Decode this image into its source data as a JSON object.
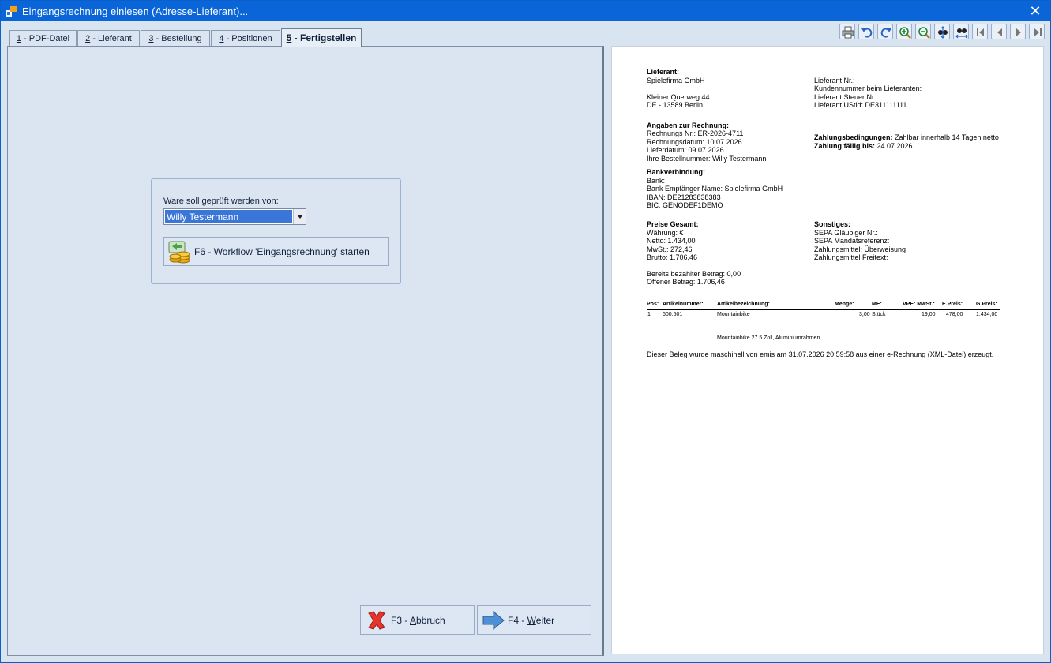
{
  "window": {
    "title": "Eingangsrechnung einlesen (Adresse-Lieferant)...",
    "close": "✕"
  },
  "tabs": [
    {
      "key": "1",
      "label": " - PDF-Datei"
    },
    {
      "key": "2",
      "label": " - Lieferant"
    },
    {
      "key": "3",
      "label": " - Bestellung"
    },
    {
      "key": "4",
      "label": " - Positionen"
    },
    {
      "key": "5",
      "label": " - Fertigstellen"
    }
  ],
  "check": {
    "label": "Ware soll geprüft werden von:",
    "selected": "Willy Testermann"
  },
  "workflow_button": "F6 - Workflow 'Eingangsrechnung' starten",
  "cancel_button": {
    "prefix": "F3 - ",
    "key": "A",
    "rest": "bbruch"
  },
  "next_button": {
    "prefix": "F4 - ",
    "key": "W",
    "rest": "eiter"
  },
  "doc": {
    "supplier_head": "Lieferant:",
    "supplier_name": "Spielefirma GmbH",
    "street": "Kleiner Querweg 44",
    "city": "DE - 13589 Berlin",
    "supplier_no": "Lieferant Nr.:",
    "customer_no": "Kundennummer beim Lieferanten:",
    "tax_no": "Lieferant Steuer Nr.:",
    "vat_id": "Lieferant UStid: DE311111111",
    "invoice_head": "Angaben zur Rechnung:",
    "invoice_no": "Rechnungs Nr.: ER-2026-4711",
    "invoice_date": "Rechnungsdatum: 10.07.2026",
    "delivery_date": "Lieferdatum: 09.07.2026",
    "order_no": "Ihre Bestellnummer: Willy Testermann",
    "terms_label": "Zahlungsbedingungen:",
    "terms_value": " Zahlbar innerhalb 14 Tagen netto",
    "due_label": "Zahlung fällig bis:",
    "due_value": " 24.07.2026",
    "bank_head": "Bankverbindung:",
    "bank": "Bank:",
    "bank_recipient": "Bank Empfänger Name: Spielefirma GmbH",
    "iban": "IBAN: DE21283838383",
    "bic": "BIC: GENODEF1DEMO",
    "prices_head": "Preise Gesamt:",
    "currency": "Währung: €",
    "net": "Netto: 1.434,00",
    "vat": "MwSt.: 272,46",
    "gross": "Brutto: 1.706,46",
    "other_head": "Sonstiges:",
    "sepa_creditor": "SEPA Gläubiger Nr.:",
    "sepa_mandate": "SEPA Mandatsreferenz:",
    "payment_method": "Zahlungsmittel: Überweisung",
    "payment_text": "Zahlungsmittel Freitext:",
    "paid": "Bereits bezahlter Betrag: 0,00",
    "open": "Offener Betrag: 1.706,46",
    "table_headers": {
      "pos": "Pos:",
      "article_no": "Artikelnummer:",
      "article_desc": "Artikelbezeichnung:",
      "qty": "Menge:",
      "unit": "ME:",
      "vpe": "VPE: MwSt.:",
      "unit_price": "E.Preis:",
      "total_price": "G.Preis:"
    },
    "row": {
      "pos": "1",
      "article_no": "500.501",
      "article_desc": "Mountainbike",
      "qty": "3,00",
      "unit": "Stück",
      "vat": "19,00",
      "unit_price": "478,00",
      "total_price": "1.434,00"
    },
    "row_detail": "Mountainbike 27.5 Zoll, Aluminiumrahmen",
    "footer": "Dieser Beleg wurde maschinell von emis am 31.07.2026  20:59:58 aus einer e-Rechnung (XML-Datei) erzeugt."
  }
}
